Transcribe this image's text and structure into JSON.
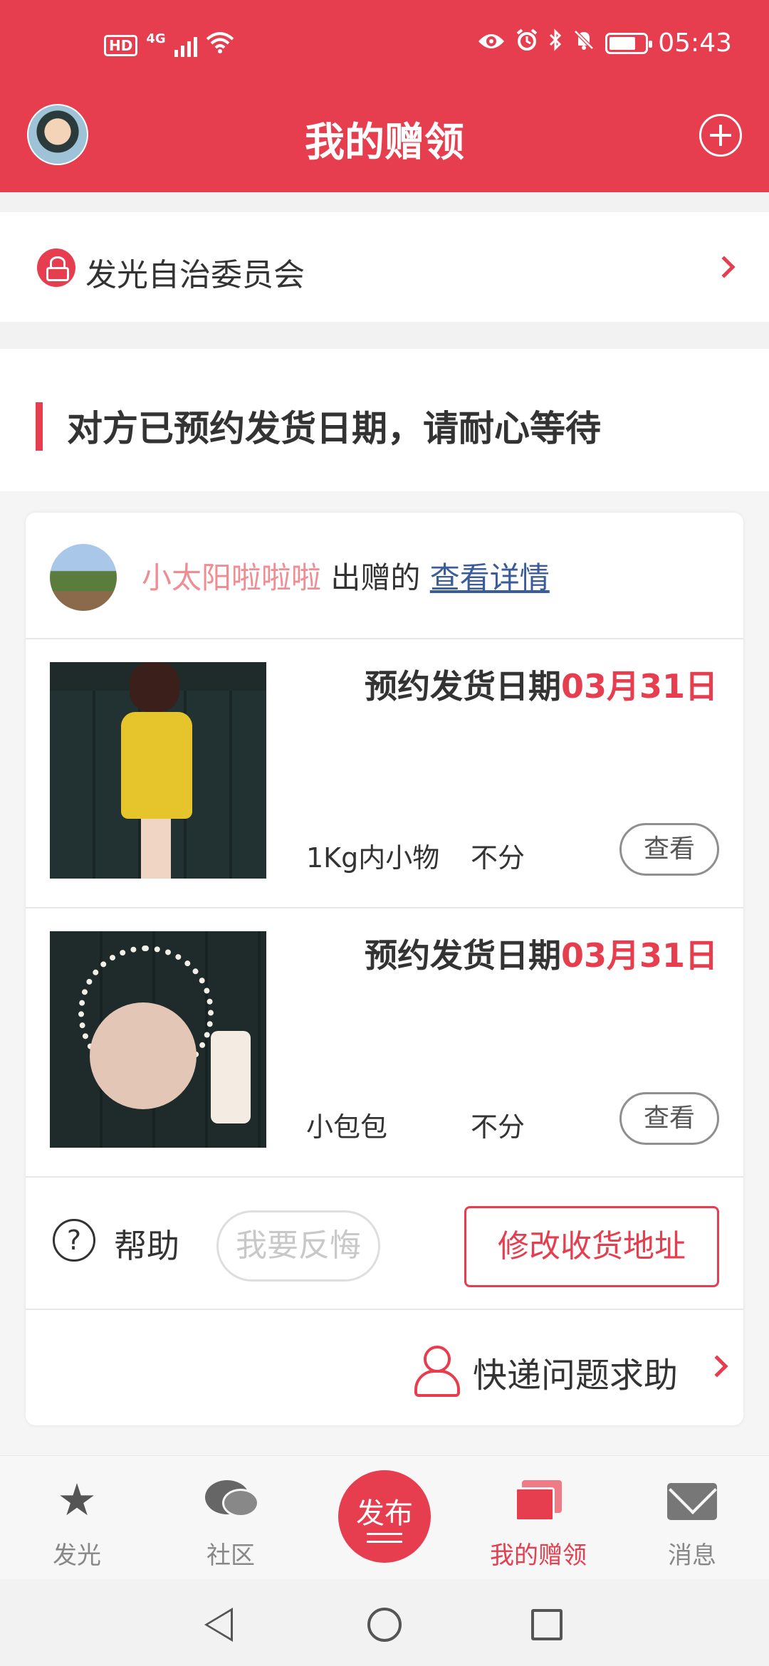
{
  "status_bar": {
    "hd": "HD",
    "network": "4G",
    "time": "05:43"
  },
  "header": {
    "title": "我的赠领"
  },
  "committee": {
    "name": "发光自治委员会"
  },
  "section": {
    "title": "对方已预约发货日期，请耐心等待"
  },
  "donor": {
    "name": "小太阳啦啦啦",
    "verb": "出赠的",
    "link": "查看详情"
  },
  "items": [
    {
      "date_label": "预约发货日期",
      "date_value": "03月31日",
      "desc": "1Kg内小物",
      "split": "不分",
      "view_label": "查看"
    },
    {
      "date_label": "预约发货日期",
      "date_value": "03月31日",
      "desc": "小包包",
      "split": "不分",
      "view_label": "查看"
    }
  ],
  "actions": {
    "help_label": "帮助",
    "regret_label": "我要反悔",
    "address_label": "修改收货地址"
  },
  "courier": {
    "label": "快递问题求助"
  },
  "bottom_nav": {
    "glow": "发光",
    "community": "社区",
    "publish": "发布",
    "my_gifts": "我的赠领",
    "messages": "消息"
  },
  "colors": {
    "brand": "#e63d4f",
    "donor_name": "#ef8d95",
    "link": "#3b5c9a"
  }
}
